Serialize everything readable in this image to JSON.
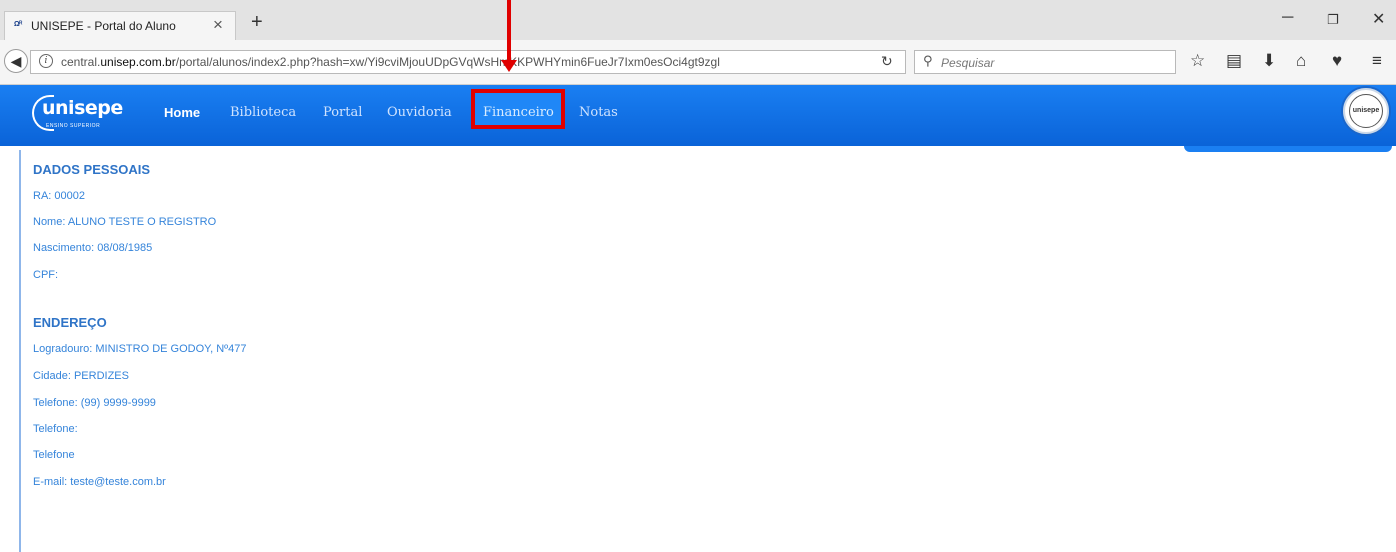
{
  "browser": {
    "tab_title": "UNISEPE - Portal do Aluno",
    "favicon_text": "Ω",
    "url_prefix": "central.",
    "url_host": "unisep.com.br",
    "url_path": "/portal/alunos/index2.php?hash=xw/Yi9cviMjouUDpGVqWsHmKKPWHYmin6FueJr7Ixm0esOci4gt9zgl",
    "search_placeholder": "Pesquisar"
  },
  "site": {
    "logo": "unisepe",
    "logo_subtitle": "ENSINO SUPERIOR",
    "avatar_text": "unisepe",
    "nav": {
      "home": "Home",
      "biblioteca": "Biblioteca",
      "portal": "Portal",
      "ouvidoria": "Ouvidoria",
      "financeiro": "Financeiro",
      "notas": "Notas"
    }
  },
  "dados_pessoais": {
    "title": "DADOS PESSOAIS",
    "ra": "RA: 00002",
    "nome": "Nome: ALUNO TESTE O REGISTRO",
    "nascimento": "Nascimento: 08/08/1985",
    "cpf": "CPF:"
  },
  "endereco": {
    "title": "ENDEREÇO",
    "logradouro": "Logradouro: MINISTRO DE GODOY, Nº477",
    "cidade": "Cidade: PERDIZES",
    "telefone1": "Telefone: (99) 9999-9999",
    "telefone2": "Telefone:",
    "telefone3": "Telefone",
    "email": "E-mail: teste@teste.com.br"
  },
  "colors": {
    "header_blue": "#0a63d8",
    "link_blue": "#3584da",
    "annotation_red": "#e00000"
  }
}
